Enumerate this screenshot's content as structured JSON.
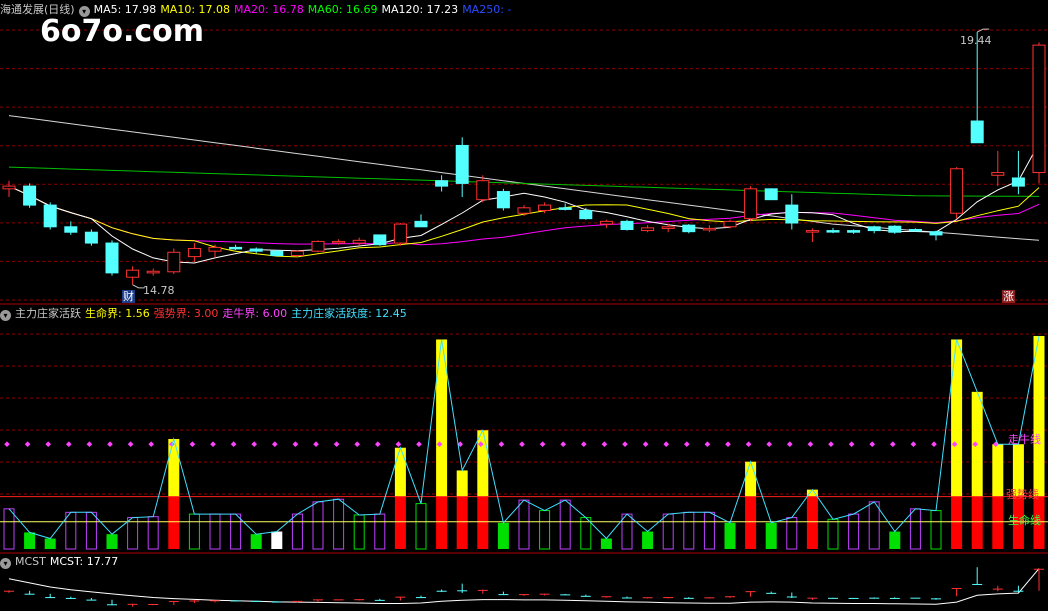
{
  "watermark": "6o7o.com",
  "price_panel": {
    "title": "海通发展(日线)",
    "ma": [
      {
        "label": "MA5: 17.98",
        "color": "#ffffff"
      },
      {
        "label": "MA10: 17.08",
        "color": "#ffff00"
      },
      {
        "label": "MA20: 16.78",
        "color": "#ff00ff"
      },
      {
        "label": "MA60: 16.69",
        "color": "#00ff00"
      },
      {
        "label": "MA120: 17.23",
        "color": "#ffffff"
      },
      {
        "label": "MA250: -",
        "color": "#2b4cff"
      }
    ],
    "high_label": "19.44",
    "low_label": "14.78",
    "badge_left": "财",
    "badge_right": "涨"
  },
  "indicator_panel": {
    "title": "主力庄家活跃",
    "items": [
      {
        "label": "生命界: 1.56",
        "color": "#ffff00"
      },
      {
        "label": "强势界: 3.00",
        "color": "#ff3030"
      },
      {
        "label": "走牛界: 6.00",
        "color": "#ff44ff"
      },
      {
        "label": "主力庄家活跃度: 12.45",
        "color": "#40e0ff"
      }
    ],
    "line_labels": {
      "bull": "走牛线",
      "strong": "强势线",
      "life": "生命线"
    },
    "levels": {
      "life": 1.56,
      "strong": 3.0,
      "bull": 6.0
    }
  },
  "mcst_panel": {
    "title": "MCST",
    "value_label": "MCST: 17.77"
  },
  "colors": {
    "up": "#ff3232",
    "down": "#54ffff",
    "grid": "#8b0000"
  },
  "chart_data": {
    "type": "candlestick",
    "ohlc": [
      [
        16.55,
        16.7,
        16.4,
        16.6
      ],
      [
        16.6,
        16.65,
        16.2,
        16.25
      ],
      [
        16.25,
        16.3,
        15.8,
        15.85
      ],
      [
        15.85,
        15.95,
        15.7,
        15.75
      ],
      [
        15.75,
        15.8,
        15.5,
        15.55
      ],
      [
        15.55,
        15.6,
        14.95,
        15.0
      ],
      [
        14.92,
        15.12,
        14.78,
        15.05
      ],
      [
        15.0,
        15.08,
        14.95,
        15.03
      ],
      [
        15.02,
        15.45,
        14.98,
        15.38
      ],
      [
        15.3,
        15.55,
        15.2,
        15.45
      ],
      [
        15.4,
        15.52,
        15.28,
        15.47
      ],
      [
        15.47,
        15.52,
        15.42,
        15.45
      ],
      [
        15.44,
        15.47,
        15.36,
        15.4
      ],
      [
        15.4,
        15.42,
        15.3,
        15.32
      ],
      [
        15.32,
        15.42,
        15.28,
        15.4
      ],
      [
        15.4,
        15.6,
        15.38,
        15.58
      ],
      [
        15.57,
        15.62,
        15.52,
        15.58
      ],
      [
        15.55,
        15.65,
        15.5,
        15.6
      ],
      [
        15.7,
        15.7,
        15.5,
        15.52
      ],
      [
        15.55,
        15.92,
        15.5,
        15.9
      ],
      [
        15.95,
        16.08,
        15.85,
        15.85
      ],
      [
        16.7,
        16.8,
        16.5,
        16.6
      ],
      [
        17.35,
        17.5,
        16.4,
        16.65
      ],
      [
        16.35,
        16.8,
        16.3,
        16.7
      ],
      [
        16.5,
        16.55,
        16.15,
        16.2
      ],
      [
        16.1,
        16.25,
        16.05,
        16.2
      ],
      [
        16.15,
        16.3,
        16.1,
        16.25
      ],
      [
        16.2,
        16.28,
        16.15,
        16.17
      ],
      [
        16.15,
        16.2,
        15.98,
        16.0
      ],
      [
        15.9,
        15.98,
        15.83,
        15.95
      ],
      [
        15.95,
        15.98,
        15.78,
        15.8
      ],
      [
        15.78,
        15.88,
        15.75,
        15.83
      ],
      [
        15.82,
        15.9,
        15.75,
        15.85
      ],
      [
        15.88,
        15.9,
        15.73,
        15.76
      ],
      [
        15.8,
        15.88,
        15.75,
        15.82
      ],
      [
        15.85,
        15.98,
        15.82,
        15.95
      ],
      [
        16.0,
        16.6,
        15.95,
        16.55
      ],
      [
        16.55,
        16.56,
        16.35,
        16.35
      ],
      [
        16.25,
        16.45,
        15.8,
        15.92
      ],
      [
        15.78,
        15.82,
        15.57,
        15.78
      ],
      [
        15.78,
        15.83,
        15.73,
        15.76
      ],
      [
        15.78,
        15.8,
        15.72,
        15.75
      ],
      [
        15.85,
        15.87,
        15.73,
        15.78
      ],
      [
        15.86,
        15.88,
        15.72,
        15.75
      ],
      [
        15.8,
        15.82,
        15.76,
        15.78
      ],
      [
        15.76,
        15.78,
        15.6,
        15.7
      ],
      [
        16.1,
        16.95,
        16.0,
        16.92
      ],
      [
        17.8,
        19.44,
        17.4,
        17.4
      ],
      [
        16.8,
        17.25,
        16.6,
        16.85
      ],
      [
        16.75,
        17.25,
        16.45,
        16.6
      ],
      [
        16.85,
        19.25,
        16.65,
        19.2
      ]
    ],
    "ylim": [
      14.5,
      19.7
    ],
    "indicator": {
      "values": [
        2.3,
        0.95,
        0.6,
        2.1,
        2.1,
        0.85,
        1.8,
        1.85,
        6.3,
        2.0,
        2.0,
        2.0,
        0.85,
        1.0,
        2.0,
        2.7,
        2.85,
        1.95,
        2.0,
        5.8,
        2.6,
        12.0,
        4.5,
        6.8,
        1.5,
        2.8,
        2.2,
        2.8,
        1.8,
        0.6,
        2.0,
        1.0,
        2.0,
        2.1,
        2.1,
        1.5,
        5.0,
        1.5,
        1.8,
        3.4,
        1.7,
        2.0,
        2.7,
        1.0,
        2.3,
        2.2,
        12.0,
        9.0,
        6.0,
        6.0,
        12.2
      ],
      "ylim": [
        0,
        13
      ]
    },
    "mcst": {
      "values": [
        17.4,
        17.25,
        17.1,
        17.0,
        16.92,
        16.85,
        16.78,
        16.72,
        16.68,
        16.65,
        16.62,
        16.6,
        16.58,
        16.56,
        16.55,
        16.54,
        16.53,
        16.52,
        16.5,
        16.5,
        16.52,
        16.58,
        16.62,
        16.64,
        16.64,
        16.63,
        16.63,
        16.62,
        16.6,
        16.58,
        16.56,
        16.55,
        16.53,
        16.52,
        16.51,
        16.51,
        16.55,
        16.56,
        16.55,
        16.52,
        16.51,
        16.5,
        16.5,
        16.49,
        16.48,
        16.47,
        16.55,
        16.8,
        16.85,
        16.88,
        17.77
      ]
    }
  }
}
